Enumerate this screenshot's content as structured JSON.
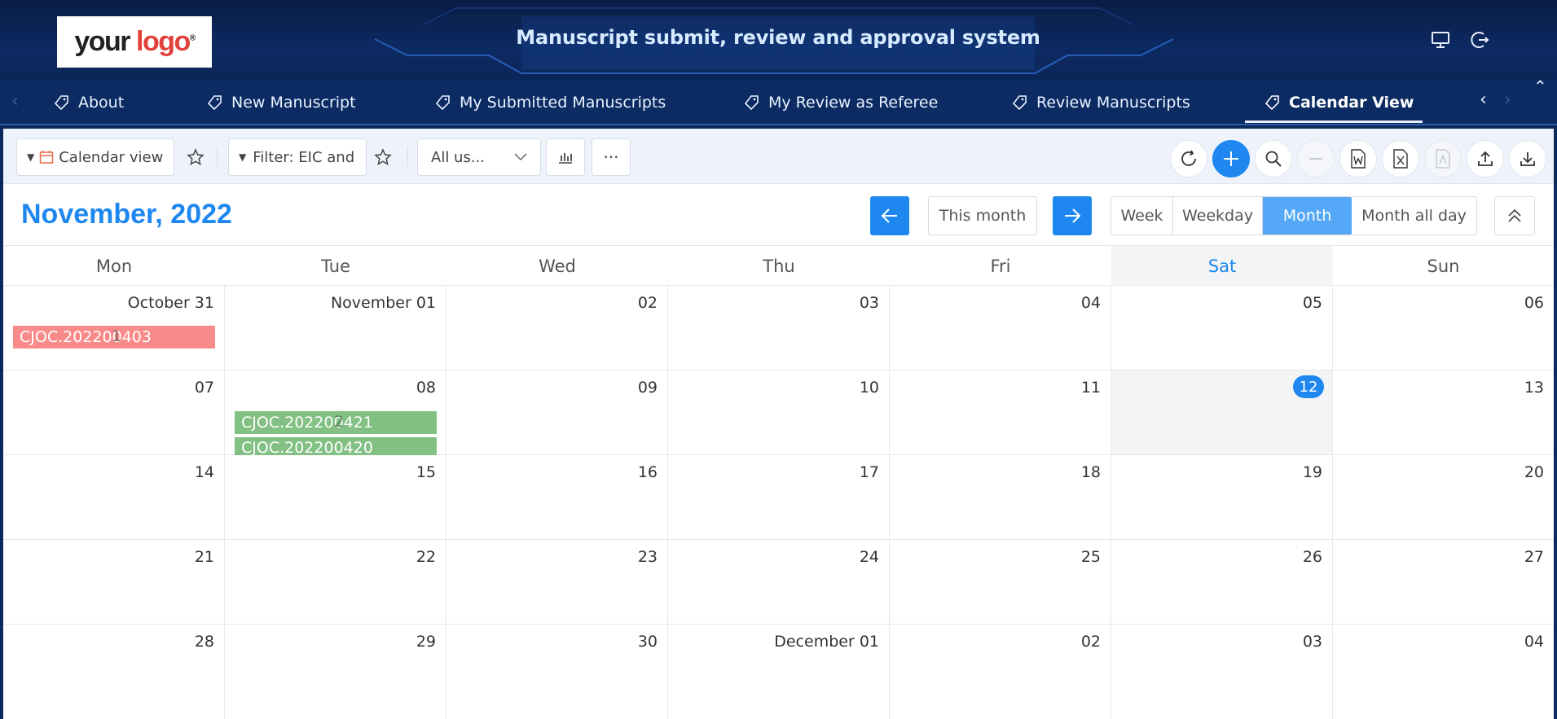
{
  "header": {
    "logo": {
      "word1": "your",
      "word2": "logo",
      "reg": "®"
    },
    "title": "Manuscript submit, review and approval system",
    "icons": [
      "monitor-icon",
      "logout-icon"
    ]
  },
  "nav": {
    "items": [
      {
        "label": "About",
        "icon": "tag-icon"
      },
      {
        "label": "New Manuscript",
        "icon": "tag-icon"
      },
      {
        "label": "My Submitted Manuscripts",
        "icon": "tag-icon"
      },
      {
        "label": "My Review as Referee",
        "icon": "tag-icon"
      },
      {
        "label": "Review Manuscripts",
        "icon": "tag-icon"
      },
      {
        "label": "Calendar View",
        "icon": "tag-icon",
        "active": true
      }
    ]
  },
  "toolbar": {
    "view_label": "Calendar view",
    "filter_label": "Filter: EIC and",
    "users_select": "All us...",
    "more_label": "···"
  },
  "calendar": {
    "month_title": "November, 2022",
    "this_month_label": "This month",
    "view_buttons": [
      "Week",
      "Weekday",
      "Month",
      "Month all day"
    ],
    "active_view": "Month",
    "weekdays": [
      "Mon",
      "Tue",
      "Wed",
      "Thu",
      "Fri",
      "Sat",
      "Sun"
    ],
    "weeks": [
      [
        "October 31",
        "November 01",
        "02",
        "03",
        "04",
        "05",
        "06"
      ],
      [
        "07",
        "08",
        "09",
        "10",
        "11",
        "12",
        "13"
      ],
      [
        "14",
        "15",
        "16",
        "17",
        "18",
        "19",
        "20"
      ],
      [
        "21",
        "22",
        "23",
        "24",
        "25",
        "26",
        "27"
      ],
      [
        "28",
        "29",
        "30",
        "December 01",
        "02",
        "03",
        "04"
      ]
    ],
    "today": "12",
    "events": {
      "week0_mon": {
        "title": "CJOC.202200403",
        "more": "1",
        "color": "#f98a8a"
      },
      "week1_tue": [
        {
          "title": "CJOC.202200421",
          "color": "#82c083"
        },
        {
          "title": "CJOC.202200420",
          "color": "#82c083"
        }
      ],
      "week1_tue_more": "2"
    }
  },
  "colors": {
    "accent": "#1e88f0",
    "header_bg": "#0c2a63",
    "event_red": "#f98a8a",
    "event_green": "#82c083"
  }
}
